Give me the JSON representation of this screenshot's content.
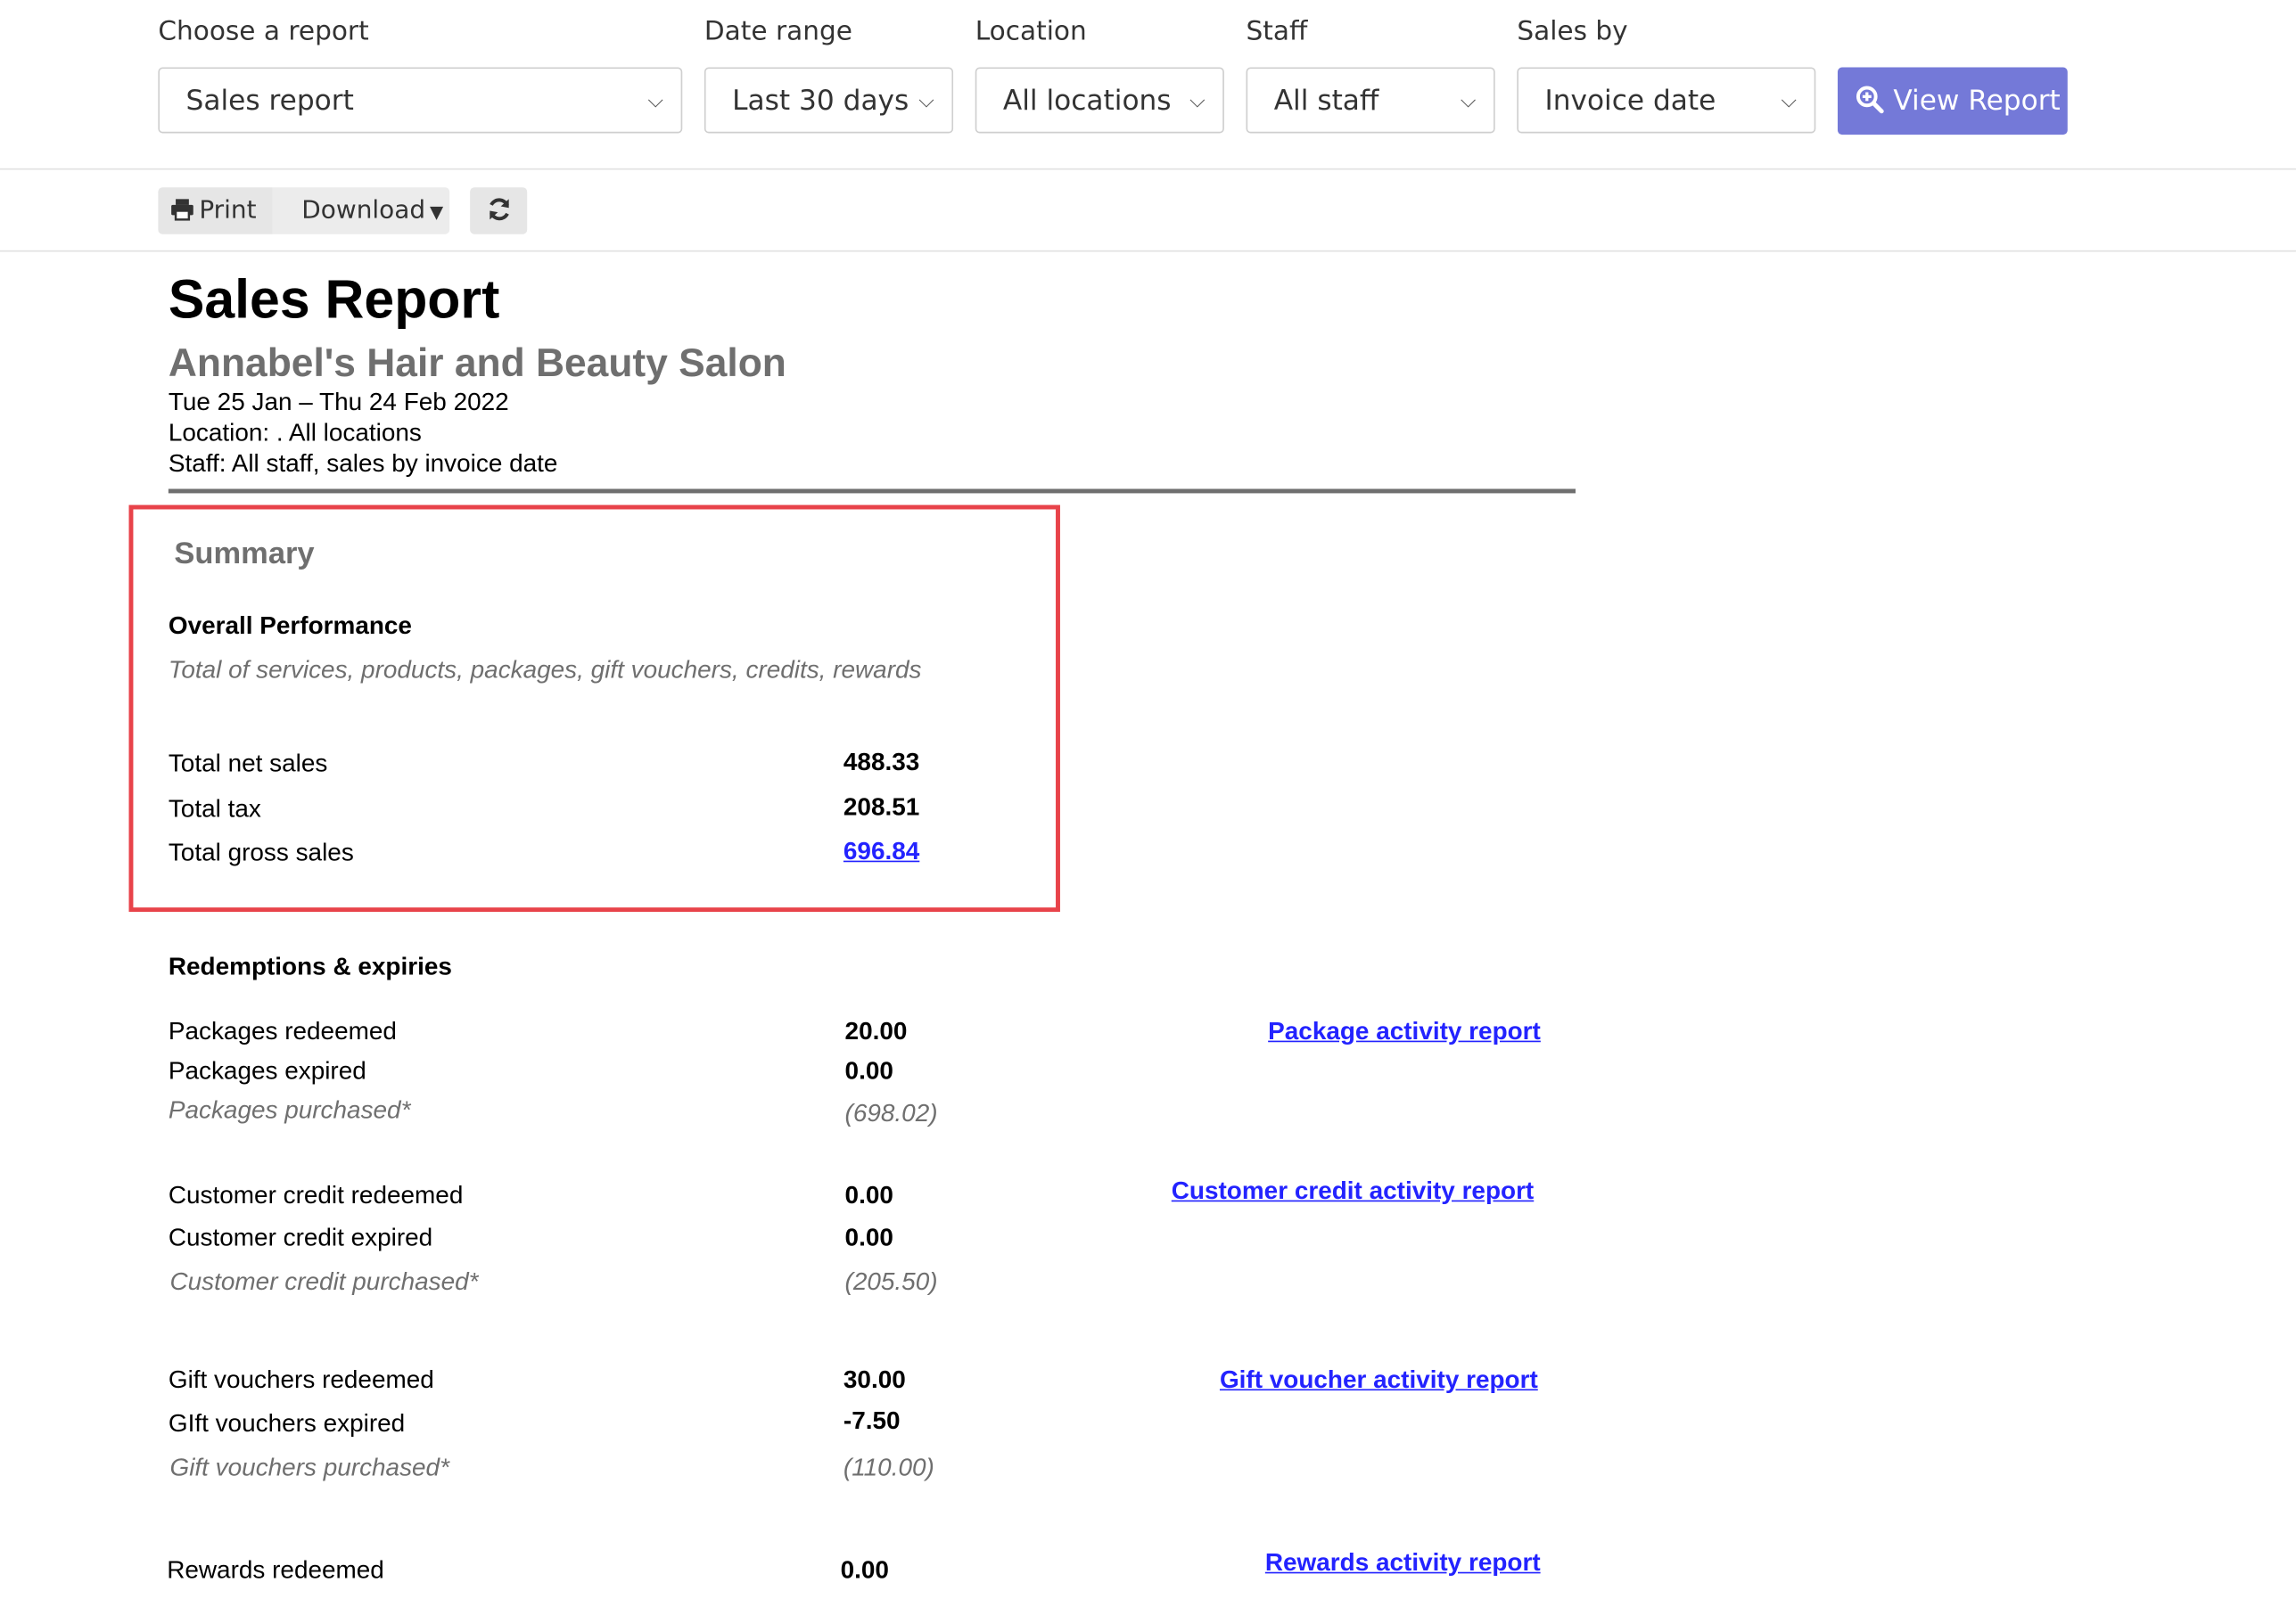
{
  "filters": {
    "report": {
      "label": "Choose a report",
      "value": "Sales report"
    },
    "date_range": {
      "label": "Date range",
      "value": "Last 30 days"
    },
    "location": {
      "label": "Location",
      "value": "All locations"
    },
    "staff": {
      "label": "Staff",
      "value": "All staff"
    },
    "sales_by": {
      "label": "Sales by",
      "value": "Invoice date"
    },
    "view_button": "View Report"
  },
  "toolbar": {
    "print": "Print",
    "download": "Download"
  },
  "report": {
    "title": "Sales Report",
    "business": "Annabel's Hair and Beauty Salon",
    "date_line": "Tue 25 Jan – Thu 24 Feb 2022",
    "location_line": "Location: . All locations",
    "staff_line": "Staff: All staff, sales by invoice date"
  },
  "summary": {
    "heading": "Summary",
    "overall_title": "Overall Performance",
    "overall_desc": "Total of services, products, packages, gift vouchers, credits, rewards",
    "rows": [
      {
        "label": "Total net sales",
        "value": "488.33"
      },
      {
        "label": "Total tax",
        "value": "208.51"
      },
      {
        "label": "Total gross sales",
        "value": "696.84"
      }
    ]
  },
  "redemptions": {
    "heading": "Redemptions & expiries",
    "packages": {
      "redeemed_label": "Packages redeemed",
      "redeemed": "20.00",
      "expired_label": "Packages expired",
      "expired": "0.00",
      "purchased_label": "Packages purchased*",
      "purchased": "(698.02)",
      "link": "Package activity report"
    },
    "credit": {
      "redeemed_label": "Customer credit redeemed",
      "redeemed": "0.00",
      "expired_label": "Customer credit expired",
      "expired": "0.00",
      "purchased_label": "Customer credit purchased*",
      "purchased": "(205.50)",
      "link": "Customer credit activity report"
    },
    "vouchers": {
      "redeemed_label": "Gift vouchers redeemed",
      "redeemed": "30.00",
      "expired_label": "GIft vouchers expired",
      "expired": "-7.50",
      "purchased_label": "Gift vouchers purchased*",
      "purchased": "(110.00)",
      "link": "Gift voucher activity report"
    },
    "rewards": {
      "redeemed_label": "Rewards redeemed",
      "redeemed": "0.00",
      "link": "Rewards activity report"
    }
  },
  "colors": {
    "primary": "#7479d8",
    "highlight": "#e8434a",
    "link": "#2323ff",
    "muted": "#6f6f6f"
  }
}
